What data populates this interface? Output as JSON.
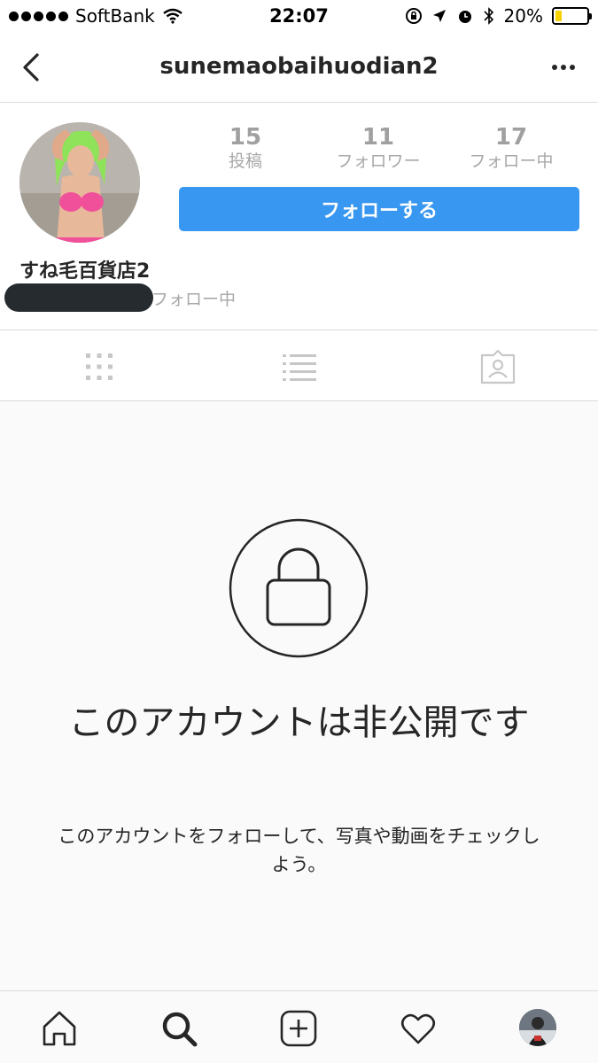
{
  "status_bar": {
    "carrier": "SoftBank",
    "time": "22:07",
    "battery": "20%",
    "battery_level": 0.2,
    "battery_color": "#f5d200"
  },
  "nav": {
    "title": "sunemaobaihuodian2",
    "back_icon": "chevron-left-icon",
    "more_icon": "more-horizontal-icon"
  },
  "profile": {
    "stats": [
      {
        "value": "15",
        "label": "投稿"
      },
      {
        "value": "11",
        "label": "フォロワー"
      },
      {
        "value": "17",
        "label": "フォロー中"
      }
    ],
    "follow_button": "フォローする",
    "display_name": "すね毛百貨店2",
    "followed_by_text": "フォロー中"
  },
  "tabs": {
    "grid_icon": "grid-icon",
    "list_icon": "list-icon",
    "tagged_icon": "tagged-photos-icon"
  },
  "private": {
    "title": "このアカウントは非公開です",
    "message": "このアカウントをフォローして、写真や動画をチェックしよう。"
  },
  "colors": {
    "accent": "#3897f0",
    "border": "#dbdbdb",
    "muted": "#a8a8a8"
  },
  "bottom_nav": {
    "items": [
      "home-icon",
      "search-icon",
      "add-post-icon",
      "activity-heart-icon",
      "profile-avatar"
    ]
  }
}
